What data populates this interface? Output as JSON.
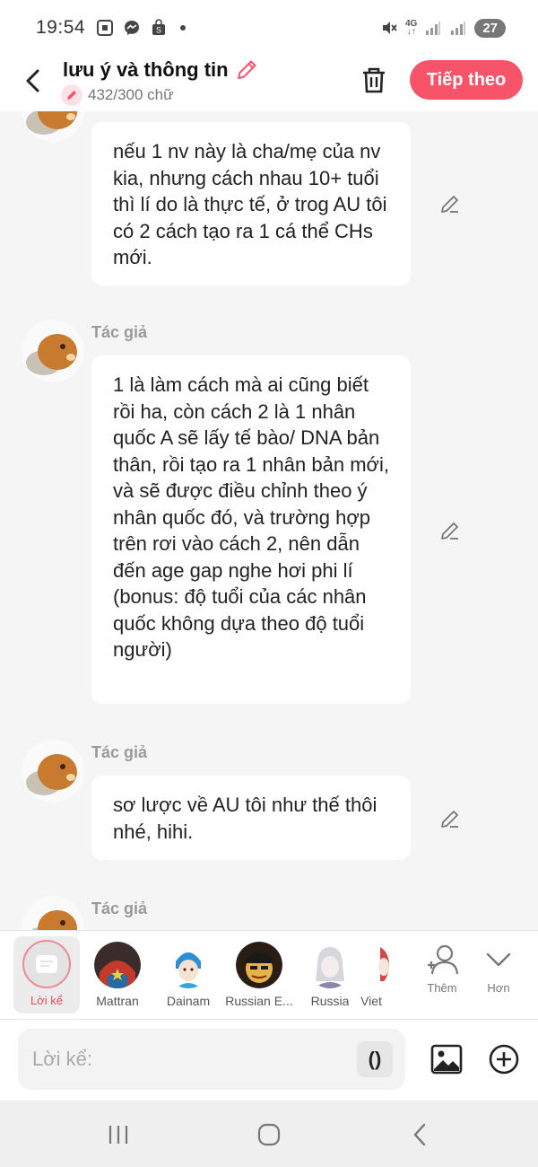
{
  "status_bar": {
    "time": "19:54",
    "network": "4G",
    "battery": "27",
    "icons": [
      "screenshot-icon",
      "messenger-icon",
      "shop-icon",
      "dot-icon",
      "mute-icon",
      "signal-icon",
      "signal-icon"
    ]
  },
  "header": {
    "title": "lưu ý và thông tin",
    "word_count": "432/300 chữ",
    "next_label": "Tiếp theo",
    "accent_color": "#f7546a"
  },
  "messages": [
    {
      "author": "",
      "text": "nếu 1 nv này là cha/mẹ của nv kia, nhưng cách nhau 10+ tuổi thì lí do là thực tế, ở trog AU tôi có 2 cách tạo ra 1 cá thể CHs mới."
    },
    {
      "author": "Tác giả",
      "text": "1 là làm cách mà ai cũng biết rồi ha, còn cách 2 là 1 nhân quốc A sẽ lấy tế bào/ DNA bản thân, rồi tạo ra 1 nhân bản mới, và sẽ được điều chỉnh theo ý nhân quốc đó, và trường hợp trên rơi vào cách 2, nên dẫn đến age gap nghe hơi phi lí (bonus: độ tuổi của các nhân quốc không dựa theo độ tuổi người)"
    },
    {
      "author": "Tác giả",
      "text": "sơ lược về AU tôi như thế thôi nhé, hihi."
    },
    {
      "author": "Tác giả",
      "text": ""
    }
  ],
  "characters": {
    "active_label": "Lời kể",
    "items": [
      {
        "name": "Mattran"
      },
      {
        "name": "Dainam"
      },
      {
        "name": "Russian E..."
      },
      {
        "name": "Russia"
      },
      {
        "name": "Viet"
      }
    ],
    "more_label": "Thêm",
    "expand_label": "Hơn"
  },
  "composer": {
    "placeholder": "Lời kể:",
    "paren_label": "()"
  }
}
